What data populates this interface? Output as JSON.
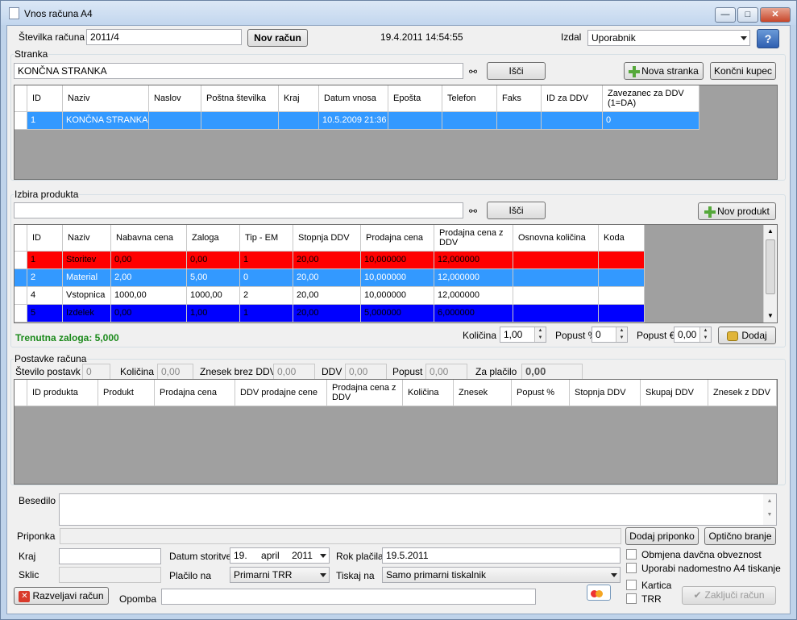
{
  "window": {
    "title": "Vnos računa A4",
    "min": "—",
    "max": "□",
    "close": "✕"
  },
  "header": {
    "invoice_number_label": "Številka računa",
    "invoice_number": "2011/4",
    "new_invoice": "Nov račun",
    "datetime": "19.4.2011 14:54:55",
    "issued_by_label": "Izdal",
    "issued_by": "Uporabnik",
    "help": "?"
  },
  "customer": {
    "group_title": "Stranka",
    "search_value": "KONČNA STRANKA",
    "search_button": "Išči",
    "new_customer": "Nova stranka",
    "end_customer": "Končni kupec",
    "columns": [
      "ID",
      "Naziv",
      "Naslov",
      "Poštna številka",
      "Kraj",
      "Datum vnosa",
      "Epošta",
      "Telefon",
      "Faks",
      "ID za DDV",
      "Zavezanec za DDV (1=DA)"
    ],
    "rows": [
      [
        "1",
        "KONČNA STRANKA",
        "",
        "",
        "",
        "10.5.2009 21:36",
        "",
        "",
        "",
        "",
        "0"
      ]
    ]
  },
  "product": {
    "group_title": "Izbira produkta",
    "search_value": "",
    "search_button": "Išči",
    "new_product": "Nov produkt",
    "columns": [
      "ID",
      "Naziv",
      "Nabavna cena",
      "Zaloga",
      "Tip - EM",
      "Stopnja DDV",
      "Prodajna cena",
      "Prodajna cena z DDV",
      "Osnovna količina",
      "Koda"
    ],
    "rows": [
      [
        "1",
        "Storitev",
        "0,00",
        "0,00",
        "1",
        "20,00",
        "10,000000",
        "12,000000",
        "",
        ""
      ],
      [
        "2",
        "Material",
        "2,00",
        "5,00",
        "0",
        "20,00",
        "10,000000",
        "12,000000",
        "",
        ""
      ],
      [
        "4",
        "Vstopnica",
        "1000,00",
        "1000,00",
        "2",
        "20,00",
        "10,000000",
        "12,000000",
        "",
        ""
      ],
      [
        "5",
        "Izdelek",
        "0,00",
        "1,00",
        "1",
        "20,00",
        "5,000000",
        "6,000000",
        "",
        ""
      ]
    ],
    "row_colors": [
      "#ff0000",
      "#3399ff",
      "#ffffff",
      "#0000ff"
    ],
    "stock_label": "Trenutna zaloga: 5,000",
    "quantity_label": "Količina",
    "quantity": "1,00",
    "discount_pct_label": "Popust %",
    "discount_pct": "0",
    "discount_eur_label": "Popust €",
    "discount_eur": "0,00",
    "add_button": "Dodaj"
  },
  "items": {
    "group_title": "Postavke računa",
    "count_label": "Število postavk",
    "count": "0",
    "qty_label": "Količina",
    "qty": "0,00",
    "net_label": "Znesek brez DDV",
    "net": "0,00",
    "vat_label": "DDV",
    "vat": "0,00",
    "discount_label": "Popust",
    "discount": "0,00",
    "pay_label": "Za plačilo",
    "pay": "0,00",
    "columns": [
      "ID produkta",
      "Produkt",
      "Prodajna cena",
      "DDV prodajne cene",
      "Prodajna cena z DDV",
      "Količina",
      "Znesek",
      "Popust %",
      "Stopnja DDV",
      "Skupaj DDV",
      "Znesek z DDV"
    ]
  },
  "footer": {
    "text_label": "Besedilo",
    "attachment_label": "Priponka",
    "add_attachment": "Dodaj priponko",
    "scan": "Optično branje",
    "place_label": "Kraj",
    "place": "",
    "service_date_label": "Datum storitve",
    "service_day": "19.",
    "service_month": "april",
    "service_year": "2011",
    "due_label": "Rok plačila",
    "due": "19.5.2011",
    "ref_label": "Sklic",
    "payment_label": "Plačilo na",
    "payment": "Primarni TRR",
    "print_label": "Tiskaj na",
    "print": "Samo primarni tiskalnik",
    "tax_obligation": "Obmjena davčna obveznost",
    "a4_print": "Uporabi nadomestno A4 tiskanje",
    "card": "Kartica",
    "trr": "TRR",
    "cancel": "Razveljavi račun",
    "note_label": "Opomba",
    "finish": "Zaključi račun"
  }
}
